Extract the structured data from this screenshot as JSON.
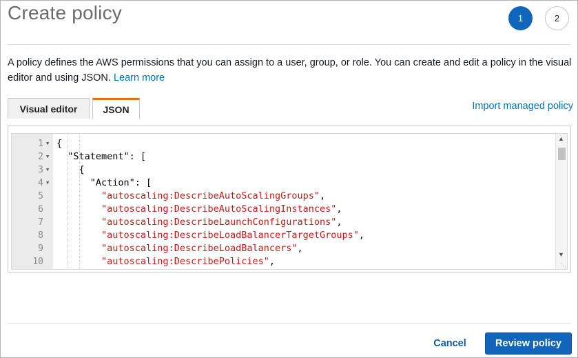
{
  "header": {
    "title": "Create policy",
    "steps": [
      "1",
      "2"
    ],
    "active_step": "1"
  },
  "description": {
    "text": "A policy defines the AWS permissions that you can assign to a user, group, or role. You can create and edit a policy in the visual editor and using JSON. ",
    "learn_more": "Learn more"
  },
  "tabs": [
    {
      "label": "Visual editor",
      "selected": false
    },
    {
      "label": "JSON",
      "selected": true
    }
  ],
  "import_link": "Import managed policy",
  "editor": {
    "lines": [
      {
        "n": "1",
        "fold": true,
        "indent": "",
        "prefix": "{",
        "str": "",
        "suffix": ""
      },
      {
        "n": "2",
        "fold": true,
        "indent": "  ",
        "prefix": "\"Statement\": [",
        "str": "",
        "suffix": ""
      },
      {
        "n": "3",
        "fold": true,
        "indent": "    ",
        "prefix": "{",
        "str": "",
        "suffix": ""
      },
      {
        "n": "4",
        "fold": true,
        "indent": "      ",
        "prefix": "\"Action\": [",
        "str": "",
        "suffix": ""
      },
      {
        "n": "5",
        "fold": false,
        "indent": "        ",
        "prefix": "",
        "str": "\"autoscaling:DescribeAutoScalingGroups\"",
        "suffix": ","
      },
      {
        "n": "6",
        "fold": false,
        "indent": "        ",
        "prefix": "",
        "str": "\"autoscaling:DescribeAutoScalingInstances\"",
        "suffix": ","
      },
      {
        "n": "7",
        "fold": false,
        "indent": "        ",
        "prefix": "",
        "str": "\"autoscaling:DescribeLaunchConfigurations\"",
        "suffix": ","
      },
      {
        "n": "8",
        "fold": false,
        "indent": "        ",
        "prefix": "",
        "str": "\"autoscaling:DescribeLoadBalancerTargetGroups\"",
        "suffix": ","
      },
      {
        "n": "9",
        "fold": false,
        "indent": "        ",
        "prefix": "",
        "str": "\"autoscaling:DescribeLoadBalancers\"",
        "suffix": ","
      },
      {
        "n": "10",
        "fold": false,
        "indent": "        ",
        "prefix": "",
        "str": "\"autoscaling:DescribePolicies\"",
        "suffix": ","
      }
    ]
  },
  "footer": {
    "cancel_label": "Cancel",
    "review_label": "Review policy"
  },
  "colors": {
    "primary": "#1166bb",
    "link": "#0073bb",
    "tab_accent": "#ec7211",
    "json_string": "#c41a16"
  }
}
